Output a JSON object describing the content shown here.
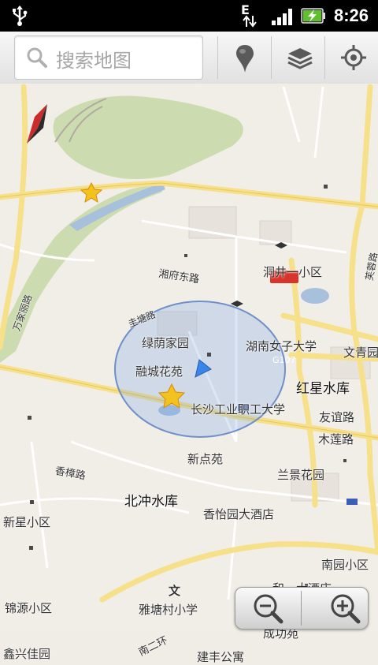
{
  "status_bar": {
    "network_type": "E",
    "time": "8:26",
    "icons": [
      "usb-icon",
      "data-arrows-icon",
      "signal-icon",
      "battery-charging-icon"
    ]
  },
  "toolbar": {
    "search_placeholder": "搜索地图",
    "buttons": [
      "places-pin-icon",
      "layers-icon",
      "my-location-icon"
    ]
  },
  "map": {
    "labels": {
      "road_xiangfu_east": "湘府东路",
      "road_wanjia_li": "万家丽路",
      "road_guitang": "圭塘路",
      "road_xiangzhang": "香樟路",
      "road_ring2_south": "南二环",
      "road_g107": "G107",
      "road_furong": "芙蓉路",
      "dongjing_district": "洞井一小区",
      "lvyin_garden": "绿荫家园",
      "hunan_women_univ": "湖南女子大学",
      "rongcheng_garden": "融城花苑",
      "wen_qingyuan": "文青园",
      "hongxing_reservoir": "红星水库",
      "changsha_college": "长沙工业职工大学",
      "youyi_road": "友谊路",
      "mulian_road": "木莲路",
      "xindian_yuan": "新点苑",
      "lanjing_garden": "兰景花园",
      "beichong_reservoir": "北冲水库",
      "xiangyi_hotel": "香怡园大酒店",
      "xinxing_district": "新星小区",
      "nanyuan_district": "南园小区",
      "heyi_hotel": "和一大酒店",
      "wen_label": "文",
      "yatang_school": "雅塘村小学",
      "jinyuan_district": "锦源小区",
      "chenggong_yuan": "成功苑",
      "xinxing_jiayuan": "鑫兴佳园",
      "jianfeng_apartment": "建丰公寓"
    }
  },
  "zoom": {
    "icons": [
      "zoom-out-icon",
      "zoom-in-icon"
    ]
  }
}
